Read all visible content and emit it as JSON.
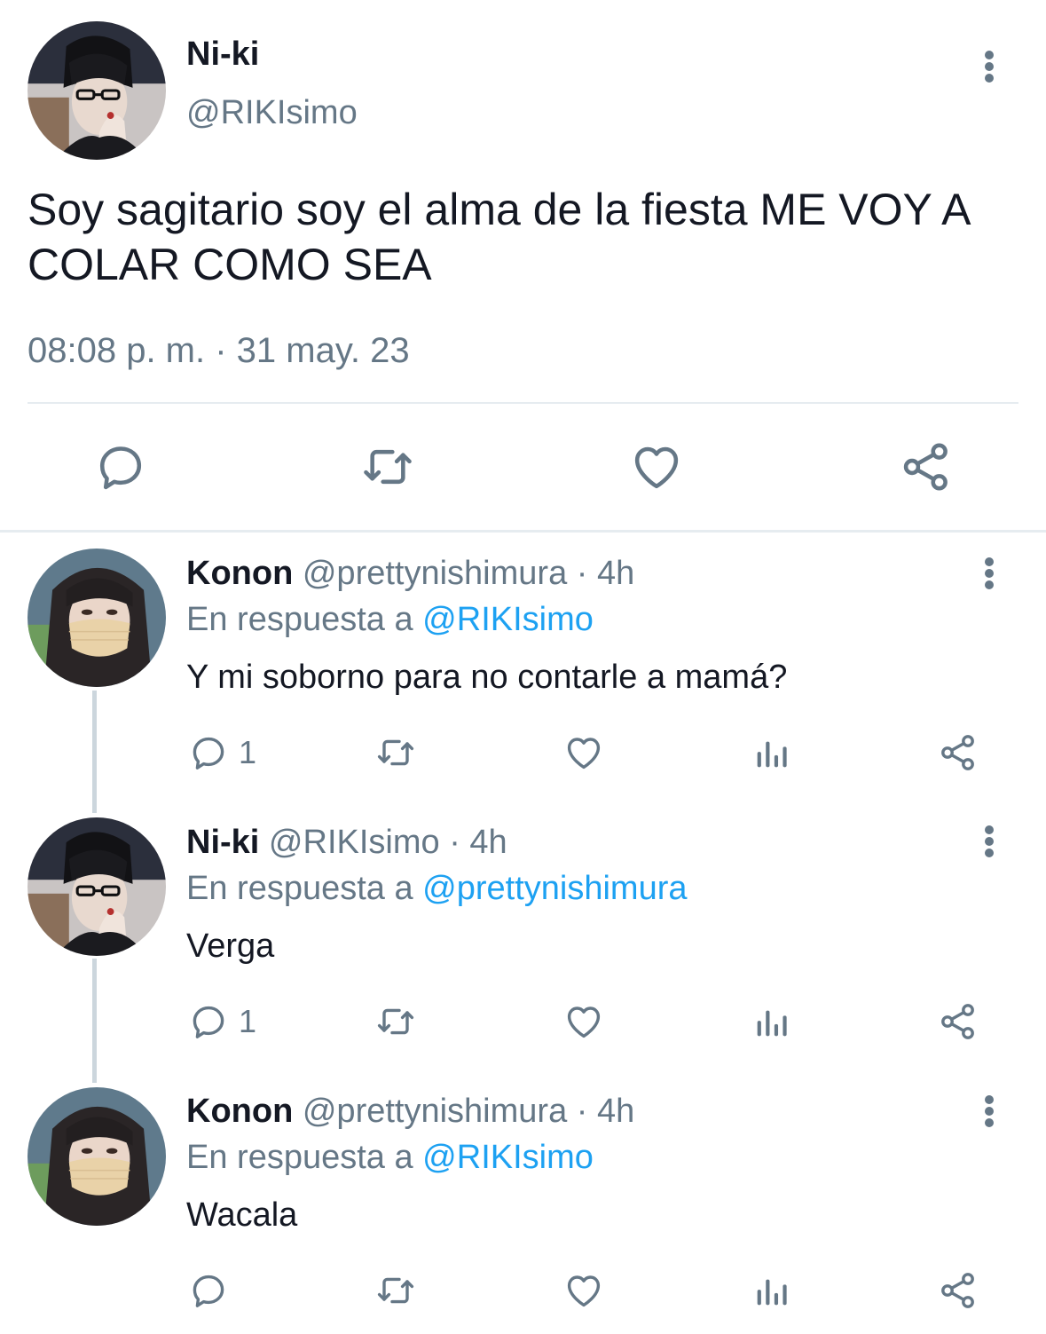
{
  "main_tweet": {
    "name": "Ni-ki",
    "handle": "@RIKIsimo",
    "text": "Soy sagitario soy el alma de la fiesta ME VOY A COLAR COMO SEA",
    "timestamp": "08:08 p. m. · 31 may. 23",
    "avatar_icon": "avatar-photo-niki",
    "actions": [
      "comment-icon",
      "retweet-icon",
      "like-icon",
      "share-icon"
    ]
  },
  "replies": [
    {
      "name": "Konon",
      "handle": "@prettynishimura",
      "time": "· 4h",
      "reply_prefix": "En respuesta a",
      "reply_to": "@RIKIsimo",
      "text": "Y mi soborno para no contarle a mamá?",
      "comment_count": "1",
      "avatar_icon": "avatar-photo-konon"
    },
    {
      "name": "Ni-ki",
      "handle": "@RIKIsimo",
      "time": "· 4h",
      "reply_prefix": "En respuesta a",
      "reply_to": "@prettynishimura",
      "text": "Verga",
      "comment_count": "1",
      "avatar_icon": "avatar-photo-niki"
    },
    {
      "name": "Konon",
      "handle": "@prettynishimura",
      "time": "· 4h",
      "reply_prefix": "En respuesta a",
      "reply_to": "@RIKIsimo",
      "text": "Wacala",
      "comment_count": "",
      "avatar_icon": "avatar-photo-konon"
    }
  ],
  "colors": {
    "text": "#141823",
    "secondary": "#657786",
    "link": "#1da1f2",
    "divider": "#e6ecf0",
    "thread_line": "#ccd6dd"
  }
}
